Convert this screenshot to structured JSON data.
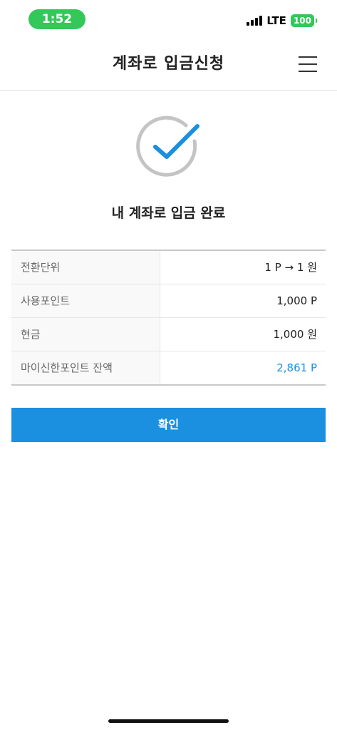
{
  "status_bar": {
    "time": "1:52",
    "network": "LTE",
    "battery": "100",
    "accent_color": "#34c759"
  },
  "header": {
    "title": "계좌로 입금신청",
    "menu_icon": "hamburger-menu-icon"
  },
  "result": {
    "icon": "check-circle-icon",
    "title": "내 계좌로 입금 완료"
  },
  "details": {
    "rows": [
      {
        "label": "전환단위",
        "value": "1 P → 1 원"
      },
      {
        "label": "사용포인트",
        "value": "1,000 P"
      },
      {
        "label": "현금",
        "value": "1,000 원"
      },
      {
        "label": "마이신한포인트 잔액",
        "value": "2,861 P"
      }
    ],
    "accent_color": "#1b8fe0"
  },
  "actions": {
    "confirm_label": "확인"
  }
}
